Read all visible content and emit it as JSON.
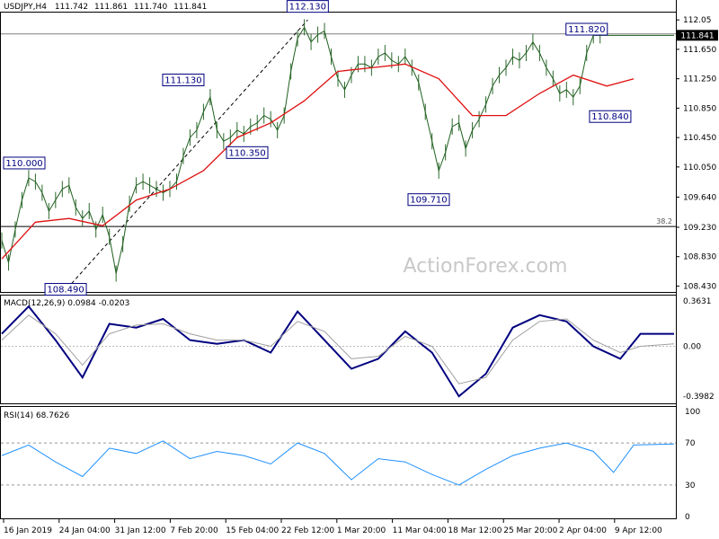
{
  "header": {
    "symbol": "USDJPY,H4",
    "open": "111.742",
    "high": "111.861",
    "low": "111.740",
    "close": "111.841"
  },
  "watermark": "ActionForex.com",
  "chart_data": [
    {
      "type": "line",
      "panel": "price",
      "series": [
        {
          "name": "",
          "color": "#000000",
          "style": "candle-approx",
          "x": [
            0,
            2,
            4,
            6,
            8,
            10,
            12,
            14,
            16,
            18,
            20,
            22,
            24,
            26,
            28,
            30,
            32,
            34,
            36,
            38,
            40,
            42,
            44,
            46,
            48,
            50,
            52,
            54,
            56,
            58,
            60,
            62,
            64,
            66,
            68,
            70,
            72,
            74,
            76,
            78,
            80,
            82,
            84,
            86,
            88,
            90,
            92,
            94,
            96,
            98,
            100,
            102,
            104,
            106,
            108,
            110,
            112,
            114,
            116,
            118,
            120,
            122,
            124,
            126,
            128,
            130,
            132,
            134,
            136,
            138,
            140,
            142,
            144,
            146,
            148,
            150,
            152,
            154,
            156,
            158,
            160,
            162,
            164,
            166,
            168,
            170,
            172,
            174,
            176,
            178,
            180,
            182,
            184,
            186,
            188,
            190,
            192,
            194,
            196,
            198,
            200
          ],
          "values": [
            109.05,
            108.75,
            109.2,
            109.6,
            109.9,
            109.85,
            109.7,
            109.45,
            109.6,
            109.75,
            109.8,
            109.5,
            109.35,
            109.45,
            109.2,
            109.4,
            109.1,
            108.6,
            109.0,
            109.55,
            109.8,
            109.85,
            109.8,
            109.75,
            109.7,
            109.75,
            109.85,
            110.2,
            110.45,
            110.55,
            110.8,
            111.0,
            110.55,
            110.4,
            110.45,
            110.55,
            110.5,
            110.6,
            110.65,
            110.75,
            110.7,
            110.55,
            110.75,
            111.35,
            111.8,
            111.95,
            111.75,
            111.85,
            111.9,
            111.55,
            111.25,
            111.1,
            111.3,
            111.45,
            111.45,
            111.4,
            111.55,
            111.6,
            111.5,
            111.45,
            111.55,
            111.4,
            111.2,
            110.8,
            110.4,
            110.0,
            110.25,
            110.6,
            110.65,
            110.3,
            110.55,
            110.7,
            110.9,
            111.15,
            111.3,
            111.4,
            111.55,
            111.5,
            111.6,
            111.75,
            111.6,
            111.4,
            111.25,
            111.05,
            111.1,
            111.0,
            111.15,
            111.6,
            111.84,
            111.84,
            111.84,
            111.84,
            111.84,
            111.84,
            111.84,
            111.84,
            111.84,
            111.84,
            111.84,
            111.84,
            111.84
          ]
        },
        {
          "name": "",
          "color": "#e01010",
          "style": "moving-average",
          "x": [
            0,
            10,
            20,
            30,
            40,
            50,
            60,
            70,
            80,
            90,
            100,
            110,
            120,
            130,
            140,
            150,
            160,
            170,
            180,
            188
          ],
          "values": [
            108.8,
            109.3,
            109.35,
            109.25,
            109.6,
            109.75,
            110.0,
            110.45,
            110.65,
            110.95,
            111.35,
            111.4,
            111.45,
            111.25,
            110.75,
            110.75,
            111.05,
            111.3,
            111.15,
            111.25
          ]
        }
      ],
      "x_ticks": [
        "16 Jan 2019",
        "24 Jan 04:00",
        "31 Jan 12:00",
        "7 Feb 20:00",
        "15 Feb 04:00",
        "22 Feb 12:00",
        "1 Mar 20:00",
        "11 Mar 04:00",
        "18 Mar 12:00",
        "25 Mar 20:00",
        "2 Apr 04:00",
        "9 Apr 12:00"
      ],
      "y_ticks": [
        "112.05",
        "111.650",
        "111.250",
        "110.850",
        "110.450",
        "110.050",
        "109.640",
        "109.230",
        "108.830",
        "108.430"
      ],
      "ylim": [
        108.35,
        112.15
      ],
      "annotations": [
        {
          "text": "112.130",
          "x": 91,
          "y": 112.13
        },
        {
          "text": "111.820",
          "x": 174,
          "y": 111.82
        },
        {
          "text": "111.130",
          "x": 54,
          "y": 111.13
        },
        {
          "text": "110.840",
          "x": 181,
          "y": 110.84
        },
        {
          "text": "110.350",
          "x": 73,
          "y": 110.35
        },
        {
          "text": "110.000",
          "x": 3,
          "y": 110.0
        },
        {
          "text": "109.710",
          "x": 127,
          "y": 109.71
        },
        {
          "text": "108.490",
          "x": 19,
          "y": 108.49
        }
      ],
      "hlines": [
        {
          "label": "38.2",
          "value": 109.24,
          "color": "#000000"
        },
        {
          "label": "",
          "value": 111.86,
          "color": "#808080"
        }
      ],
      "grid": false
    },
    {
      "type": "line",
      "panel": "macd",
      "title": "MACD(12,26,9) 0.0984 -0.0203",
      "x": [
        0,
        8,
        16,
        24,
        32,
        40,
        48,
        56,
        64,
        72,
        80,
        88,
        96,
        104,
        112,
        120,
        128,
        136,
        144,
        152,
        160,
        168,
        176,
        184,
        190,
        200
      ],
      "series": [
        {
          "name": "",
          "color": "#000080",
          "values": [
            0.1,
            0.32,
            0.05,
            -0.25,
            0.18,
            0.15,
            0.22,
            0.05,
            0.02,
            0.05,
            -0.05,
            0.28,
            0.05,
            -0.18,
            -0.1,
            0.12,
            -0.05,
            -0.4,
            -0.22,
            0.15,
            0.25,
            0.2,
            0.0,
            -0.1,
            0.1,
            0.1
          ]
        },
        {
          "name": "",
          "color": "#a0a0a0",
          "values": [
            0.05,
            0.25,
            0.1,
            -0.15,
            0.1,
            0.17,
            0.18,
            0.1,
            0.05,
            0.05,
            0.0,
            0.2,
            0.12,
            -0.1,
            -0.08,
            0.08,
            0.0,
            -0.3,
            -0.25,
            0.05,
            0.2,
            0.22,
            0.05,
            -0.05,
            0.0,
            0.02
          ]
        }
      ],
      "y_ticks": [
        "0.3631",
        "0.00",
        "-0.3982"
      ],
      "ylim": [
        -0.45,
        0.4
      ]
    },
    {
      "type": "line",
      "panel": "rsi",
      "title": "RSI(14) 68.7626",
      "x": [
        0,
        8,
        16,
        24,
        32,
        40,
        48,
        56,
        64,
        72,
        80,
        88,
        96,
        104,
        112,
        120,
        128,
        136,
        144,
        152,
        160,
        168,
        176,
        182,
        188,
        200
      ],
      "series": [
        {
          "name": "",
          "color": "#1e90ff",
          "values": [
            58,
            68,
            52,
            38,
            65,
            60,
            72,
            55,
            62,
            58,
            50,
            70,
            60,
            35,
            55,
            52,
            40,
            30,
            45,
            58,
            65,
            70,
            62,
            42,
            68,
            69
          ]
        }
      ],
      "y_ticks": [
        "100",
        "70",
        "30",
        "0"
      ],
      "ylim": [
        0,
        100
      ],
      "levels": [
        70,
        30
      ]
    }
  ]
}
